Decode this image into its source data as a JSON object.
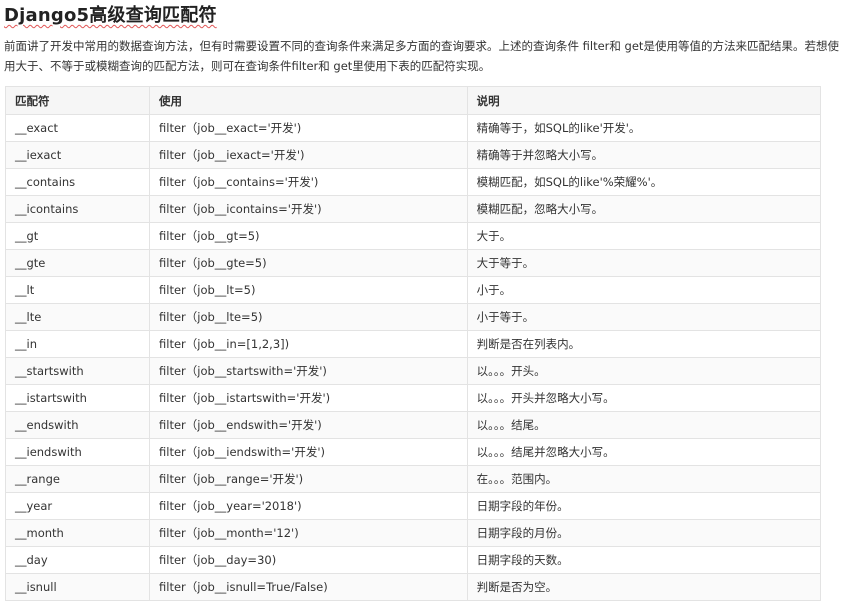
{
  "title": "Django5高级查询匹配符",
  "intro": "前面讲了开发中常用的数据查询方法，但有时需要设置不同的查询条件来满足多方面的查询要求。上述的查询条件 filter和 get是使用等值的方法来匹配结果。若想使用大于、不等于或模糊查询的匹配方法，则可在查询条件filter和 get里使用下表的匹配符实现。",
  "table": {
    "headers": [
      "匹配符",
      "使用",
      "说明"
    ],
    "rows": [
      {
        "op": "__exact",
        "usage": "filter（job__exact='开发')",
        "desc": "精确等于，如SQL的like'开发'。"
      },
      {
        "op": "__iexact",
        "usage": "filter（job__iexact='开发')",
        "desc": "精确等于并忽略大小写。"
      },
      {
        "op": "__contains",
        "usage": "filter（job__contains='开发')",
        "desc": "模糊匹配，如SQL的like'%荣耀%'。"
      },
      {
        "op": "__icontains",
        "usage": "filter（job__icontains='开发')",
        "desc": "模糊匹配，忽略大小写。"
      },
      {
        "op": "__gt",
        "usage": "filter（job__gt=5)",
        "desc": "大于。"
      },
      {
        "op": "__gte",
        "usage": "filter（job__gte=5)",
        "desc": "大于等于。"
      },
      {
        "op": "__lt",
        "usage": "filter（job__lt=5)",
        "desc": "小于。"
      },
      {
        "op": "__lte",
        "usage": "filter（job__lte=5)",
        "desc": "小于等于。"
      },
      {
        "op": "__in",
        "usage": "filter（job__in=[1,2,3])",
        "desc": "判断是否在列表内。"
      },
      {
        "op": "__startswith",
        "usage": "filter（job__startswith='开发')",
        "desc": "以。。。开头。"
      },
      {
        "op": "__istartswith",
        "usage": "filter（job__istartswith='开发')",
        "desc": "以。。。开头并忽略大小写。"
      },
      {
        "op": "__endswith",
        "usage": "filter（job__endswith='开发')",
        "desc": "以。。。结尾。"
      },
      {
        "op": "__iendswith",
        "usage": "filter（job__iendswith='开发')",
        "desc": "以。。。结尾并忽略大小写。"
      },
      {
        "op": "__range",
        "usage": "filter（job__range='开发')",
        "desc": "在。。。范围内。"
      },
      {
        "op": "__year",
        "usage": "filter（job__year='2018')",
        "desc": "日期字段的年份。"
      },
      {
        "op": "__month",
        "usage": "filter（job__month='12')",
        "desc": "日期字段的月份。"
      },
      {
        "op": "__day",
        "usage": "filter（job__day=30)",
        "desc": "日期字段的天数。"
      },
      {
        "op": "__isnull",
        "usage": "filter（job__isnull=True/False)",
        "desc": "判断是否为空。"
      }
    ]
  }
}
